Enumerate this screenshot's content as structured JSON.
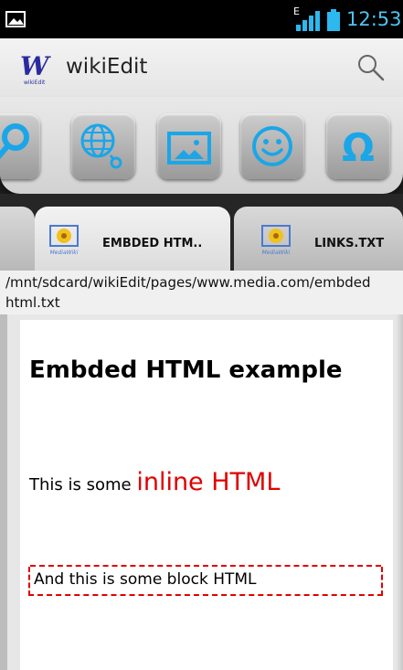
{
  "status_bar": {
    "network_type": "E",
    "time": "12:53",
    "icons": [
      "picture-icon",
      "signal-icon",
      "battery-icon"
    ]
  },
  "action_bar": {
    "logo_icon": "wikiedit-logo",
    "logo_letter": "W",
    "logo_caption": "wikiEdit",
    "title": "wikiEdit",
    "search_icon": "search-icon"
  },
  "toolbar": {
    "buttons": [
      {
        "icon": "link-icon"
      },
      {
        "icon": "external-link-globe-icon"
      },
      {
        "icon": "image-icon"
      },
      {
        "icon": "smiley-icon"
      },
      {
        "icon": "omega-symbol-icon",
        "glyph": "Ω"
      }
    ],
    "accent_color": "#1aa6e8"
  },
  "tabs": [
    {
      "label": "",
      "icon": "mediawiki-icon",
      "active": false
    },
    {
      "label": "EMBDED HTM..",
      "icon": "mediawiki-icon",
      "icon_caption": "MediaWiki",
      "active": true
    },
    {
      "label": "LINKS.TXT",
      "icon": "mediawiki-icon",
      "icon_caption": "MediaWiki",
      "active": false
    }
  ],
  "file_path": "/mnt/sdcard/wikiEdit/pages/www.media.com/embded html.txt",
  "document": {
    "title": "Embded HTML example",
    "inline_prefix": "This is some ",
    "inline_highlight": "inline HTML",
    "block_text": "And this is some block HTML",
    "highlight_color": "#e00000"
  }
}
